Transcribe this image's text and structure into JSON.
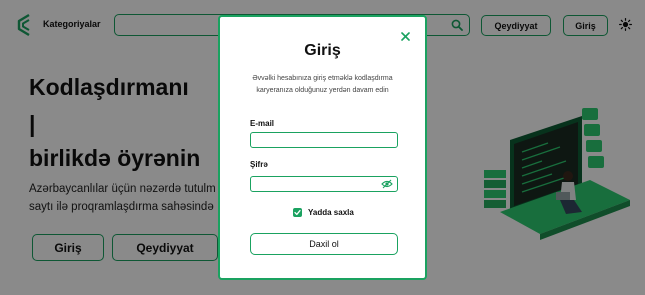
{
  "colors": {
    "accent": "#1aa260",
    "overlay": "rgba(0,0,0,0.46)"
  },
  "header": {
    "logo_icon": "brand-logo-icon",
    "categories_label": "Kategoriyalar",
    "search_value": "",
    "search_icon": "search-icon",
    "register_label": "Qeydiyyat",
    "login_label": "Giriş",
    "theme_icon": "sun-icon"
  },
  "hero": {
    "title_line1": "Kodlaşdırmanı",
    "title_line2": "|",
    "title_line3": "birlikdə öyrənin",
    "desc_line1": "Azərbaycanlılar üçün nəzərdə tutulm",
    "desc_line2": "saytı ilə proqramlaşdırma sahəsində",
    "login_button": "Giriş",
    "register_button": "Qeydiyyat"
  },
  "modal": {
    "title": "Giriş",
    "subtitle": "Əvvəlki hesabınıza giriş etməklə kodlaşdırma karyeranıza olduğunuz yerdən davam edin",
    "email_label": "E-mail",
    "email_value": "",
    "password_label": "Şifrə",
    "password_value": "",
    "remember_label": "Yadda saxla",
    "remember_checked": true,
    "submit_label": "Daxil ol",
    "close_icon": "close-icon",
    "eye_icon": "eye-slash-icon"
  }
}
